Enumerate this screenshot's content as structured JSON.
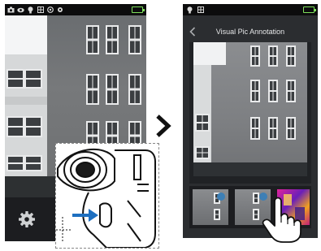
{
  "left_screen": {
    "status_icons": [
      "camera-icon",
      "eye-icon",
      "bulb-icon",
      "grid-icon",
      "target-icon",
      "settings-gear-icon"
    ],
    "battery_color": "#7ee05b",
    "settings_button_icon": "gear-icon"
  },
  "inset": {
    "arrow_color": "#1e6fc0"
  },
  "transition": {
    "icon": "chevron-right-icon"
  },
  "right_screen": {
    "status_icons": [
      "bulb-icon",
      "grid-icon"
    ],
    "battery_color": "#7ee05b",
    "title": "Visual Pic Annotation",
    "back_icon": "chevron-left-icon",
    "thumbnails": [
      {
        "type": "visual"
      },
      {
        "type": "visual"
      },
      {
        "type": "thermal"
      }
    ],
    "gesture_icon": "tap-hand-icon"
  }
}
